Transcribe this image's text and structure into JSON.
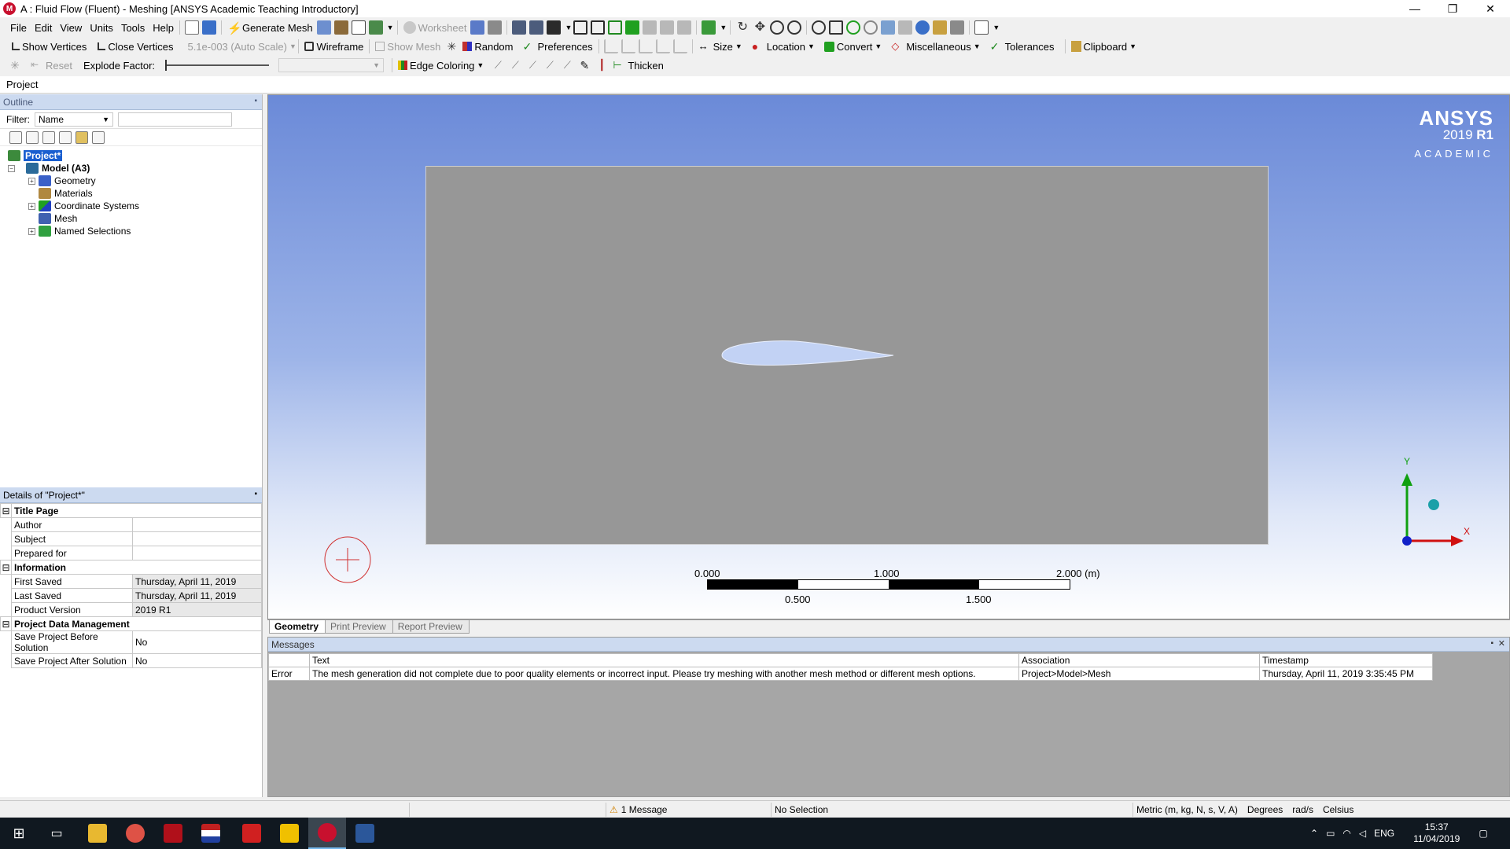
{
  "window": {
    "title": "A : Fluid Flow (Fluent) - Meshing [ANSYS Academic Teaching Introductory]",
    "app_icon_letter": "M",
    "minimize": "—",
    "maximize": "❐",
    "close": "✕"
  },
  "menu": [
    "File",
    "Edit",
    "View",
    "Units",
    "Tools",
    "Help"
  ],
  "toolbar1": {
    "generate_mesh": "Generate Mesh",
    "worksheet": "Worksheet"
  },
  "toolbar2": {
    "show_vertices": "Show Vertices",
    "close_vertices": "Close Vertices",
    "auto_scale": "5.1e-003 (Auto Scale)",
    "wireframe": "Wireframe",
    "show_mesh": "Show Mesh",
    "random": "Random",
    "preferences": "Preferences",
    "size": "Size",
    "location": "Location",
    "convert": "Convert",
    "miscellaneous": "Miscellaneous",
    "tolerances": "Tolerances",
    "clipboard": "Clipboard"
  },
  "toolbar3": {
    "reset": "Reset",
    "explode_factor": "Explode Factor:",
    "edge_coloring": "Edge Coloring",
    "thicken": "Thicken"
  },
  "project_bar": "Project",
  "outline": {
    "header": "Outline",
    "filter_label": "Filter:",
    "filter_value": "Name",
    "tree": {
      "project": "Project*",
      "model": "Model (A3)",
      "children": [
        "Geometry",
        "Materials",
        "Coordinate Systems",
        "Mesh",
        "Named Selections"
      ]
    }
  },
  "details": {
    "header": "Details of \"Project*\"",
    "title_page": "Title Page",
    "author": "Author",
    "subject": "Subject",
    "prepared_for": "Prepared for",
    "information": "Information",
    "first_saved": "First Saved",
    "first_saved_value": "Thursday, April 11, 2019",
    "last_saved": "Last Saved",
    "last_saved_value": "Thursday, April 11, 2019",
    "product_version": "Product Version",
    "product_version_value": "2019 R1",
    "pdm": "Project Data Management",
    "save_before": "Save Project Before Solution",
    "save_before_value": "No",
    "save_after": "Save Project After Solution",
    "save_after_value": "No"
  },
  "viewport": {
    "brand_line1": "ANSYS",
    "brand_line2_year": "2019",
    "brand_line2_rel": "R1",
    "brand_line3": "ACADEMIC",
    "scale_top": [
      "0.000",
      "1.000",
      "2.000 (m)"
    ],
    "scale_bottom": [
      "0.500",
      "1.500"
    ],
    "axis_y": "Y",
    "axis_x": "X"
  },
  "view_tabs": [
    "Geometry",
    "Print Preview",
    "Report Preview"
  ],
  "messages": {
    "header": "Messages",
    "columns": [
      "Text",
      "Association",
      "Timestamp"
    ],
    "rows": [
      {
        "type": "Error",
        "text": "The mesh generation did not complete due to poor quality elements or incorrect input. Please try meshing with another mesh method or different mesh options.",
        "association": "Project>Model>Mesh",
        "timestamp": "Thursday, April 11, 2019 3:35:45 PM"
      }
    ]
  },
  "status": {
    "messages": "1 Message",
    "selection": "No Selection",
    "units": "Metric (m, kg, N, s, V, A)",
    "angle": "Degrees",
    "angular_velocity": "rad/s",
    "temperature": "Celsius"
  },
  "taskbar": {
    "lang": "ENG",
    "time": "15:37",
    "date": "11/04/2019",
    "apps": [
      "start-menu",
      "task-view",
      "file-explorer",
      "chrome",
      "acrobat",
      "flag-app",
      "solidworks-2018",
      "autodesk-app",
      "ansys-meshing",
      "word"
    ]
  },
  "colors": {
    "viewport_top": "#6b8ad8",
    "domain_fill": "#979797",
    "airfoil_fill": "#c2d2f4",
    "axis_x": "#d01010",
    "axis_y": "#10a010",
    "axis_z": "#1020c8"
  }
}
